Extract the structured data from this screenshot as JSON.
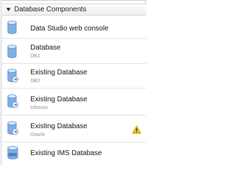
{
  "section": {
    "title": "Database Components",
    "items": [
      {
        "name": "Data Studio web console",
        "icon": "cylinder-icon"
      },
      {
        "name": "Database",
        "subtitle": "DB2",
        "icon": "cylinder-icon"
      },
      {
        "name": "Existing Database",
        "subtitle": "DB2",
        "icon": "database-link-icon"
      },
      {
        "name": "Existing Database",
        "subtitle": "Informix",
        "icon": "database-link-icon"
      },
      {
        "name": "Existing Database",
        "subtitle": "Oracle",
        "icon": "database-link-icon",
        "warning": "warning-icon"
      },
      {
        "name": "Existing IMS Database",
        "icon": "ims-database-icon",
        "icon_text": "IMS"
      }
    ]
  },
  "colors": {
    "cylinder_blue": "#7fb0e3",
    "warning_yellow": "#f2c21a"
  }
}
